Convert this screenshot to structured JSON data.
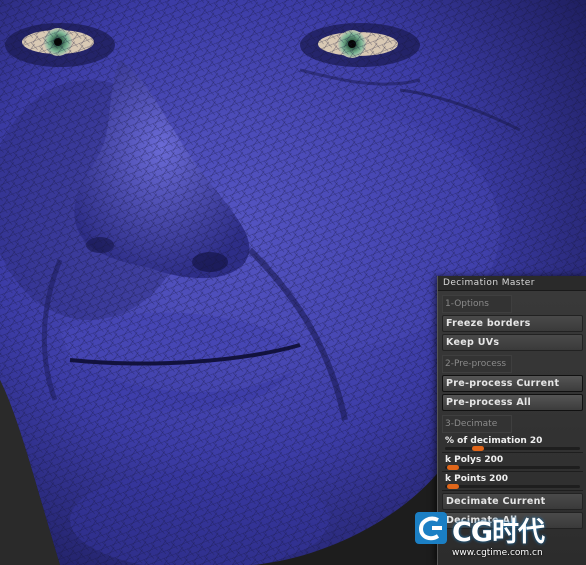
{
  "panel": {
    "title": "Decimation Master",
    "section1": "1-Options",
    "freeze_borders": "Freeze borders",
    "keep_uvs": "Keep UVs",
    "section2": "2-Pre-process",
    "preprocess_current": "Pre-process Current",
    "preprocess_all": "Pre-process All",
    "section3": "3-Decimate",
    "slider_decimation": {
      "label": "% of decimation 20",
      "value": 20,
      "fraction": 0.2
    },
    "slider_kpolys": {
      "label": "k Polys 200",
      "value": 200,
      "fraction": 0.0
    },
    "slider_kpoints": {
      "label": "k Points 200",
      "value": 200,
      "fraction": 0.0
    },
    "decimate_current": "Decimate Current",
    "decimate_all": "Decimate All",
    "accent_color": "#e0661a"
  },
  "watermark": {
    "brand": "CG时代",
    "url": "www.cgtime.com.cn",
    "logo_icon": "cgtime-logo-icon"
  },
  "viewport": {
    "subject": "sculpt-face-mesh",
    "mesh_color": "#3a3aa0",
    "eye_color": "#6fa88a"
  }
}
